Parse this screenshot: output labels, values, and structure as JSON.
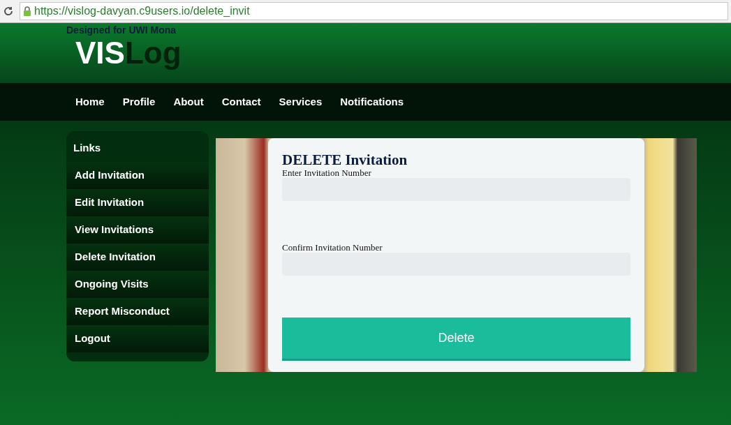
{
  "browser": {
    "url": "https://vislog-davyan.c9users.io/delete_invit"
  },
  "header": {
    "tagline": "Designed for UWI Mona",
    "logo_first": "VIS",
    "logo_second": "Log"
  },
  "nav": [
    "Home",
    "Profile",
    "About",
    "Contact",
    "Services",
    "Notifications"
  ],
  "sidebar": {
    "title": "Links",
    "items": [
      "Add Invitation",
      "Edit Invitation",
      "View Invitations",
      "Delete Invitation",
      "Ongoing Visits",
      "Report Misconduct",
      "Logout"
    ]
  },
  "form": {
    "title": "DELETE Invitation",
    "fields": [
      {
        "label": "Enter Invitation Number"
      },
      {
        "label": "Confirm Invitation Number"
      }
    ],
    "button": "Delete"
  }
}
